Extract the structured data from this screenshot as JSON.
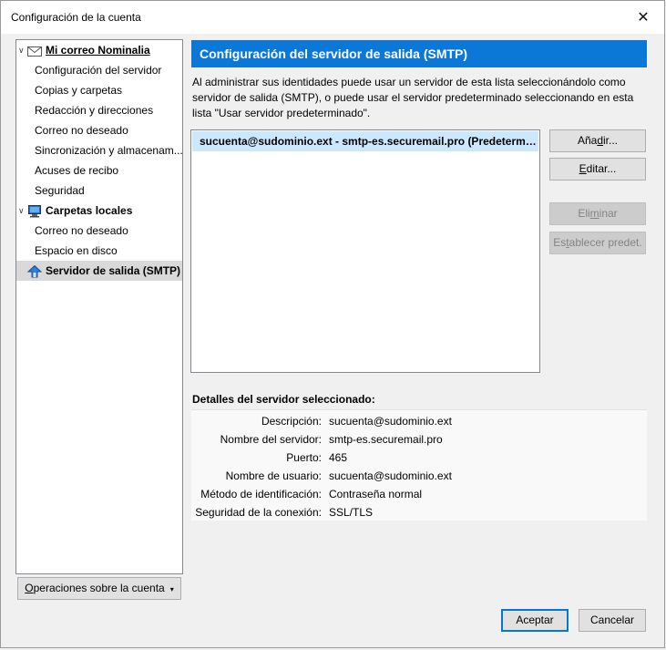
{
  "window": {
    "title": "Configuración de la cuenta",
    "close_glyph": "✕"
  },
  "tree": {
    "accounts": [
      {
        "label_underlined": "Mi correo Nominalia",
        "icon": "mail-envelope-icon",
        "children": [
          "Configuración del servidor",
          "Copias y carpetas",
          "Redacción y direcciones",
          "Correo no deseado",
          "Sincronización y almacenam...",
          "Acuses de recibo",
          "Seguridad"
        ]
      },
      {
        "label": "Carpetas locales",
        "icon": "local-folders-computer-icon",
        "children": [
          "Correo no deseado",
          "Espacio en disco"
        ]
      }
    ],
    "smtp_item": {
      "label": "Servidor de salida (SMTP)",
      "icon": "outgoing-server-icon",
      "selected": true
    }
  },
  "operations_button": {
    "label_underlined": "O",
    "label_rest": "peraciones sobre la cuenta",
    "caret": "▾"
  },
  "smtp_panel": {
    "header": "Configuración del servidor de salida (SMTP)",
    "description": "Al administrar sus identidades puede usar un servidor de esta lista seleccionándolo como servidor de salida (SMTP), o puede usar el servidor predeterminado seleccionando en esta lista \"Usar servidor predeterminado\".",
    "servers": [
      "sucuenta@sudominio.ext - smtp-es.securemail.pro (Predeterminado)"
    ],
    "buttons": {
      "add": {
        "pre": "Aña",
        "ul": "d",
        "post": "ir..."
      },
      "edit": {
        "pre": "",
        "ul": "E",
        "post": "ditar..."
      },
      "delete": {
        "pre": "Eli",
        "ul": "m",
        "post": "inar"
      },
      "set_default": {
        "pre": "Es",
        "ul": "t",
        "post": "ablecer predet."
      }
    },
    "details_title": "Detalles del servidor seleccionado:",
    "details": [
      {
        "label": "Descripción:",
        "value": "sucuenta@sudominio.ext"
      },
      {
        "label": "Nombre del servidor:",
        "value": "smtp-es.securemail.pro"
      },
      {
        "label": "Puerto:",
        "value": "465"
      },
      {
        "label": "Nombre de usuario:",
        "value": "sucuenta@sudominio.ext"
      },
      {
        "label": "Método de identificación:",
        "value": "Contraseña normal"
      },
      {
        "label": "Seguridad de la conexión:",
        "value": "SSL/TLS"
      }
    ]
  },
  "dialog_buttons": {
    "ok": "Aceptar",
    "cancel": "Cancelar"
  },
  "colors": {
    "header_blue": "#0b78d7",
    "selected_row": "#cce8ff",
    "tree_selected": "#d9d9d9"
  }
}
